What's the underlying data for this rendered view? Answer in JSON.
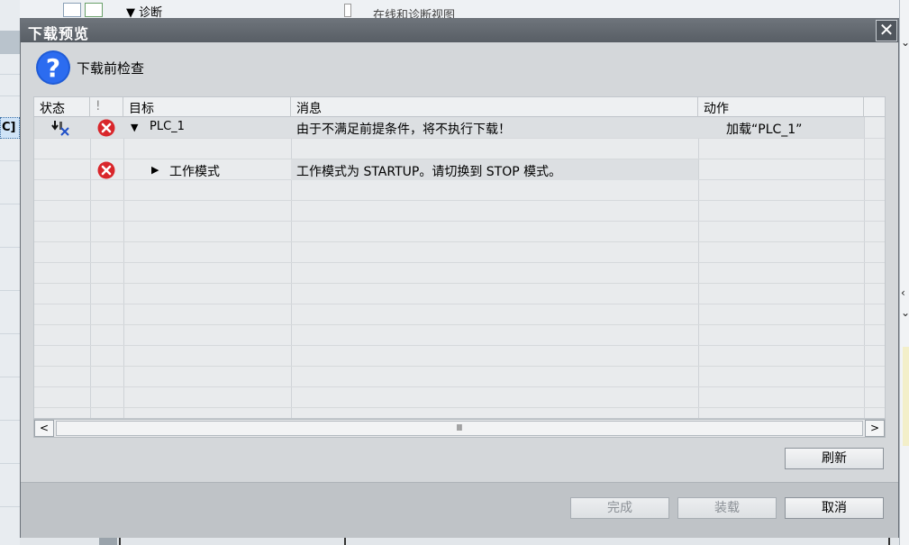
{
  "background": {
    "left_cell_fragment": "C]",
    "toolbar_label": "▼ 诊断",
    "toolbar_label_2": "在线和诊断视图"
  },
  "dialog": {
    "title": "下载预览",
    "heading": "下载前检查",
    "close_label": "✕",
    "columns": {
      "status": "状态",
      "warning": "!",
      "target": "目标",
      "message": "消息",
      "action": "动作"
    },
    "rows": [
      {
        "status_icon": "download-icon",
        "severity_icon": "error-icon",
        "expand_icon": "caret-down-icon",
        "target": "PLC_1",
        "message": "由于不满足前提条件，将不执行下载！",
        "action": "加载“PLC_1”"
      },
      {
        "status_icon": "",
        "severity_icon": "error-icon",
        "expand_icon": "caret-right-icon",
        "target": "工作模式",
        "message": "工作模式为 STARTUP。请切换到 STOP 模式。",
        "action": ""
      }
    ],
    "scrollbar": {
      "left_label": "<",
      "right_label": ">",
      "thumb_grip": "Ⅲ"
    },
    "buttons": {
      "refresh": "刷新",
      "finish": "完成",
      "load": "装载",
      "cancel": "取消"
    },
    "colors": {
      "titlebar": "#5f656c",
      "error_red": "#d9262b",
      "help_blue": "#1f5bd6"
    }
  }
}
